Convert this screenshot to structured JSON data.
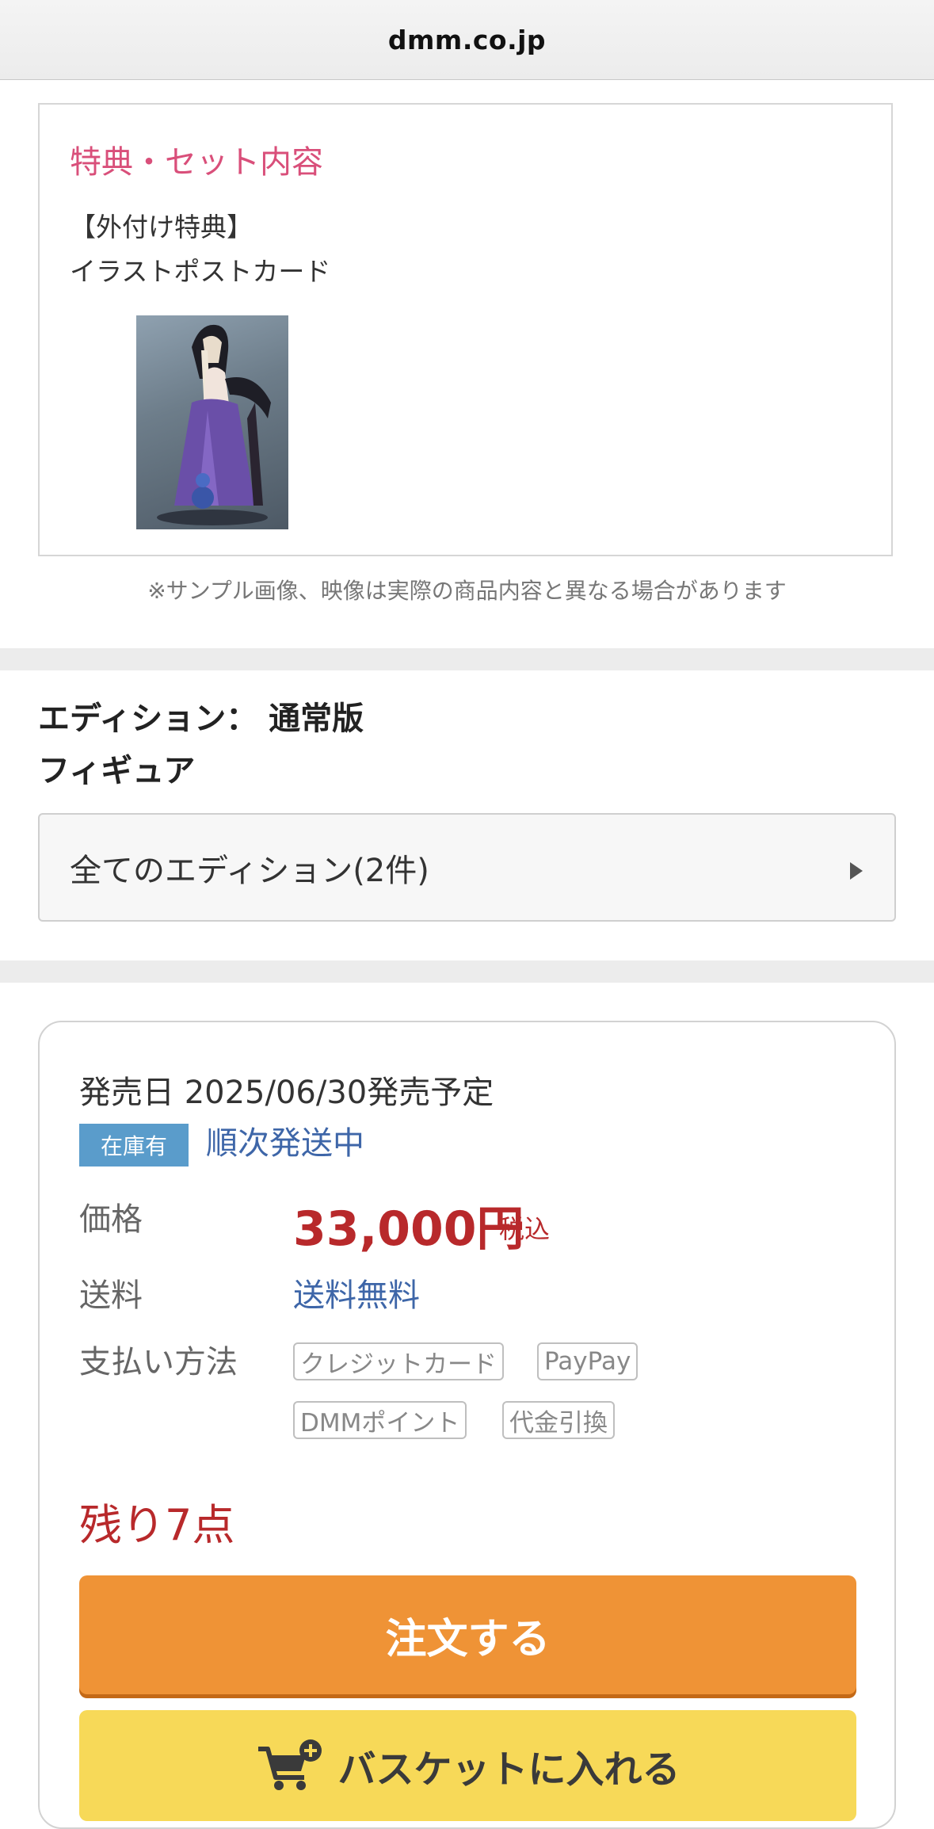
{
  "browser": {
    "url": "dmm.co.jp"
  },
  "bonus": {
    "title": "特典・セット内容",
    "line1": "【外付け特典】",
    "line2": "イラストポストカード",
    "image_alt": "illustration-postcard-figure"
  },
  "note": "※サンプル画像、映像は実際の商品内容と異なる場合があります",
  "edition": {
    "label": "エディション： 通常版",
    "category": "フィギュア",
    "select_text": "全てのエディション(2件)"
  },
  "purchase": {
    "release": "発売日 2025/06/30発売予定",
    "stock_badge": "在庫有",
    "shipping_status": "順次発送中",
    "price_label": "価格",
    "price_value": "33,000円",
    "price_tax": "税込",
    "shipping_label": "送料",
    "shipping_value": "送料無料",
    "payment_label": "支払い方法",
    "payment_methods": [
      "クレジットカード",
      "PayPay",
      "DMMポイント",
      "代金引換"
    ],
    "remaining": "残り7点",
    "order_button": "注文する",
    "basket_button": "バスケットに入れる"
  },
  "colors": {
    "accent_pink": "#d94f7a",
    "price_red": "#b8292b",
    "link_blue": "#3e66a8",
    "badge_blue": "#5a9ccb",
    "order_orange": "#ef9336",
    "basket_yellow": "#f7d958"
  }
}
